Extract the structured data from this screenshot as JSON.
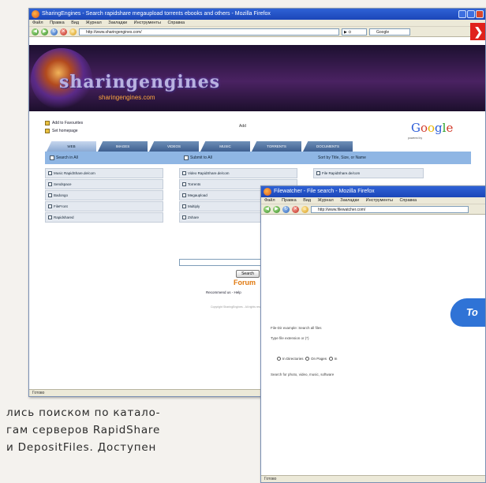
{
  "window1": {
    "title": "SharingEngines - Search rapidshare megaupload torrents ebooks and others - Mozilla Firefox",
    "menu": [
      "Файл",
      "Правка",
      "Вид",
      "Журнал",
      "Закладки",
      "Инструменты",
      "Справка"
    ],
    "url": "http://www.sharingengines.com/",
    "search_placeholder": "Google",
    "status": "Готово",
    "logo": "sharingengines",
    "logo_sub": "sharingengines.com",
    "page": {
      "links": [
        "Add to Favourites",
        "Set homepage"
      ],
      "gadget_label": "Add",
      "google_letters": [
        "G",
        "o",
        "o",
        "g",
        "l",
        "e"
      ],
      "powered_by": "powered by",
      "tabs": [
        "WEB",
        "IMAGES",
        "VIDEOS",
        "MUSIC",
        "TORRENTS",
        "DOCUMENTS"
      ],
      "checkbar": [
        "Search in All",
        "Submit to All",
        "Sort by Title, Size, or Name"
      ],
      "grid": [
        [
          "Music RapidShare.de/com",
          "Video RapidShare.de/com",
          "File RapidShare.de/com"
        ],
        [
          "Sendspace",
          "Torrents",
          ""
        ],
        [
          "Badongo",
          "Megaupload",
          ""
        ],
        [
          "FileFront",
          "Multiply",
          ""
        ],
        [
          "Rapidshared",
          "Zshare",
          ""
        ]
      ],
      "search_button": "Search",
      "forum": "Forum",
      "recommend": "Recommend us - Help",
      "fine_print": "Copyright SharingEngines - All rights reserved"
    }
  },
  "window2": {
    "title": "Filewatcher - File search - Mozilla Firefox",
    "menu": [
      "Файл",
      "Правка",
      "Вид",
      "Журнал",
      "Закладки",
      "Инструменты",
      "Справка"
    ],
    "url": "http://www.filewatcher.com/",
    "status": "Готово",
    "logo_text": "To",
    "line_a": "File-Dir example: Search all files",
    "line_b": "Type file extension or (*)",
    "radios": [
      "In Directories",
      "On Pages",
      "In"
    ],
    "line_c": "Search for photo, video, music, software"
  },
  "article": {
    "lines": [
      "лись поиском по катало-",
      "гам серверов RapidShare",
      "и DepositFiles. Доступен"
    ]
  }
}
